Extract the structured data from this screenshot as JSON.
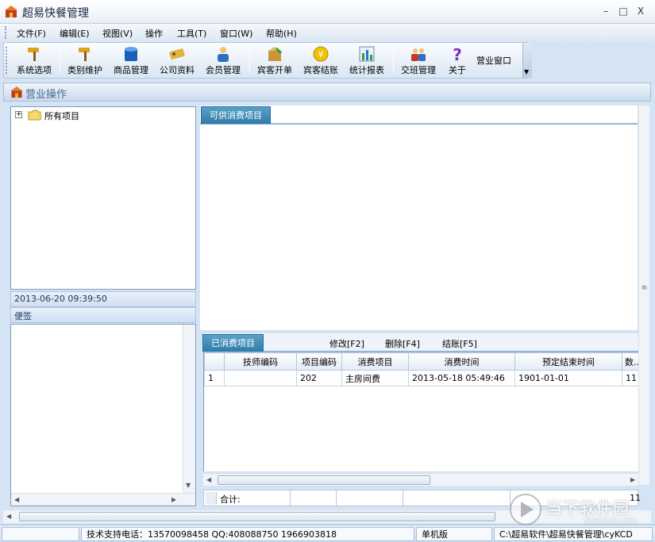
{
  "window": {
    "title": "超易快餐管理",
    "controls": [
      "–",
      "□",
      "X"
    ]
  },
  "menubar": {
    "items": [
      "文件(F)",
      "编辑(E)",
      "视图(V)",
      "操作",
      "工具(T)",
      "窗口(W)",
      "帮助(H)"
    ]
  },
  "toolbar": {
    "buttons": [
      {
        "label": "系统选项",
        "icon": "hammer-icon"
      },
      {
        "label": "类别维护",
        "icon": "hammer-icon"
      },
      {
        "label": "商品管理",
        "icon": "database-icon"
      },
      {
        "label": "公司资料",
        "icon": "key-icon"
      },
      {
        "label": "会员管理",
        "icon": "user-icon"
      },
      {
        "label": "宾客开单",
        "icon": "package-icon"
      },
      {
        "label": "宾客结账",
        "icon": "coin-icon"
      },
      {
        "label": "统计报表",
        "icon": "bar-chart-icon"
      },
      {
        "label": "交班管理",
        "icon": "users-icon"
      },
      {
        "label": "关于",
        "icon": "help-icon"
      }
    ],
    "window_label": "营业窗口"
  },
  "panel": {
    "title": "营业操作"
  },
  "tree": {
    "root_label": "所有项目",
    "expander": "+"
  },
  "datetime": "2013-06-20 09:39:50",
  "notes": {
    "label": "便签"
  },
  "available": {
    "tab_label": "可供消费项目"
  },
  "consumed": {
    "tab_label": "已消费项目",
    "actions": [
      "修改[F2]",
      "删除[F4]",
      "结账[F5]"
    ],
    "columns": [
      "",
      "技师编码",
      "项目编码",
      "消费项目",
      "消费时间",
      "预定结束时间",
      "数..."
    ],
    "rows": [
      [
        "1",
        "",
        "202",
        "主房间费",
        "2013-05-18 05:49:46",
        "1901-01-01",
        "11"
      ]
    ],
    "total_label": "合计:",
    "total_value": "11"
  },
  "statusbar": {
    "support": "技术支持电话：13570098458 QQ:408088750 1966903818",
    "edition": "单机版",
    "path": "C:\\超易软件\\超易快餐管理\\cyKCD"
  },
  "watermark": {
    "text": "当下软件园",
    "sub": "downxia.com"
  },
  "colors": {
    "accent_tab": "#2f7ca8",
    "background": "#d4e4f4"
  }
}
